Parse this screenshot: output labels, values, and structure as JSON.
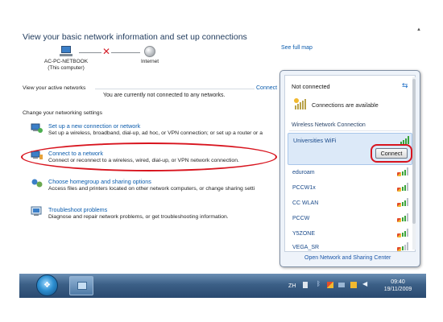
{
  "main": {
    "title": "View your basic network information and set up connections",
    "see_full_map": "See full map",
    "map": {
      "computer_name": "AC-PC-NETBOOK",
      "computer_sub": "(This computer)",
      "internet_label": "Internet"
    },
    "active_networks": {
      "label": "View your active networks",
      "message": "You are currently not connected to any networks.",
      "connect_to_link": "Connect"
    },
    "change_settings": {
      "label": "Change your networking settings",
      "tasks": [
        {
          "title": "Set up a new connection or network",
          "desc": "Set up a wireless, broadband, dial-up, ad hoc, or VPN connection; or set up a router or a"
        },
        {
          "title": "Connect to a network",
          "desc": "Connect or reconnect to a wireless, wired, dial-up, or VPN network connection."
        },
        {
          "title": "Choose homegroup and sharing options",
          "desc": "Access files and printers located on other network computers, or change sharing setti"
        },
        {
          "title": "Troubleshoot problems",
          "desc": "Diagnose and repair network problems, or get troubleshooting information."
        }
      ]
    }
  },
  "popup": {
    "status": "Not connected",
    "available": "Connections are available",
    "section_header": "Wireless Network Connection",
    "selected_network": "Universities WiFi",
    "connect_button": "Connect",
    "networks": [
      "eduroam",
      "PCCW1x",
      "CC WLAN",
      "PCCW",
      "Y5ZONE",
      "VEGA_SR"
    ],
    "footer_link": "Open Network and Sharing Center"
  },
  "taskbar": {
    "language": "ZH",
    "time": "09:40",
    "date": "19/11/2009"
  },
  "colors": {
    "accent_red": "#d8141e",
    "link_blue": "#0b5cad",
    "signal_green": "#3aa33a"
  }
}
